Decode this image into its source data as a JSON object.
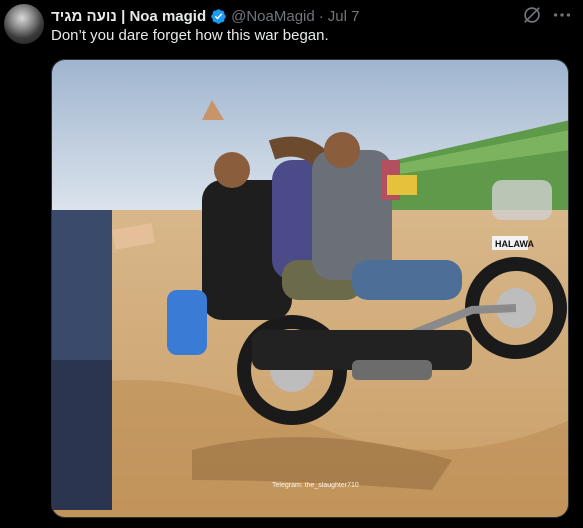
{
  "post": {
    "display_name": "נועה מגיד | Noa magid",
    "handle": "@NoaMagid",
    "separator": "·",
    "date": "Jul 7",
    "text": "Don’t you dare forget how this war began.",
    "verified_badge_color": "#1d9bf0"
  },
  "media": {
    "license_plate": "HALAWA",
    "watermark": "Telegram: the_slaughter710"
  },
  "icons": {
    "grok": "grok-icon",
    "more": "more-icon",
    "verified": "verified-badge-icon"
  }
}
